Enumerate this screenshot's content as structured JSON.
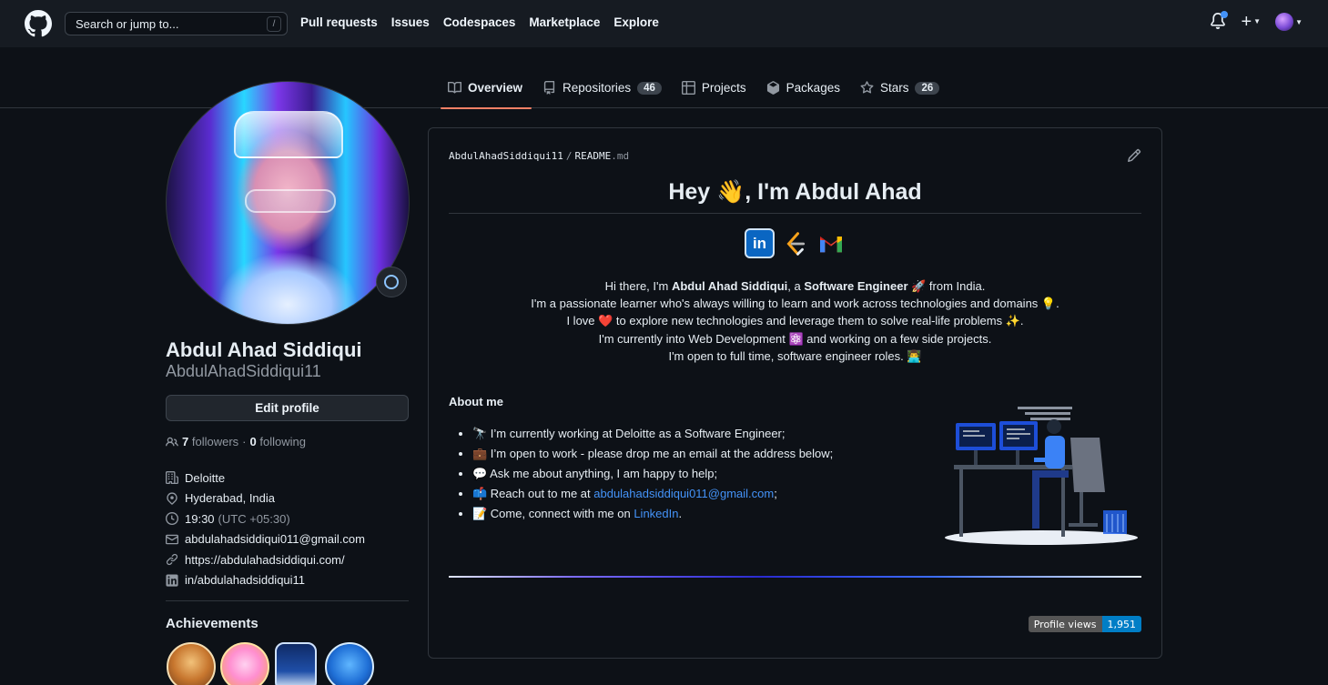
{
  "header": {
    "search_placeholder": "Search or jump to...",
    "search_shortcut": "/",
    "nav": [
      "Pull requests",
      "Issues",
      "Codespaces",
      "Marketplace",
      "Explore"
    ]
  },
  "tabs": [
    {
      "label": "Overview",
      "icon": "book-icon",
      "active": true
    },
    {
      "label": "Repositories",
      "icon": "repo-icon",
      "count": "46"
    },
    {
      "label": "Projects",
      "icon": "table-icon"
    },
    {
      "label": "Packages",
      "icon": "package-icon"
    },
    {
      "label": "Stars",
      "icon": "star-icon",
      "count": "26"
    }
  ],
  "profile": {
    "name": "Abdul Ahad Siddiqui",
    "login": "AbdulAhadSiddiqui11",
    "edit_label": "Edit profile",
    "followers_count": "7",
    "followers_label": "followers",
    "separator": "·",
    "following_count": "0",
    "following_label": "following",
    "company": "Deloitte",
    "location": "Hyderabad, India",
    "time": "19:30",
    "timezone": "(UTC +05:30)",
    "email": "abdulahadsiddiqui011@gmail.com",
    "website": "https://abdulahadsiddiqui.com/",
    "linkedin": "in/abdulahadsiddiqui11"
  },
  "achievements": {
    "title": "Achievements"
  },
  "readme": {
    "owner": "AbdulAhadSiddiqui11",
    "separator": "/",
    "file": "README",
    "ext": ".md",
    "heading": "Hey 👋, I'm Abdul Ahad",
    "intro": [
      {
        "before": "Hi there, I'm ",
        "bold1": "Abdul Ahad Siddiqui",
        "mid": ", a ",
        "bold2": "Software Engineer",
        "after": " 🚀 from India."
      },
      "I'm a passionate learner who's always willing to learn and work across technologies and domains 💡.",
      "I love ❤️ to explore new technologies and leverage them to solve real-life problems ✨.",
      "I'm currently into Web Development ⚛️ and working on a few side projects.",
      "I'm open to full time, software engineer roles. 👨‍💻"
    ],
    "about_title": "About me",
    "about_items": [
      {
        "text": "🔭 I’m currently working at Deloitte as a Software Engineer;"
      },
      {
        "text": "💼 I’m open to work - please drop me an email at the address below;"
      },
      {
        "text": "💬 Ask me about anything, I am happy to help;"
      },
      {
        "text": "📫 Reach out to me at ",
        "link": "abdulahadsiddiqui011@gmail.com",
        "after": ";"
      },
      {
        "text": "📝 Come, connect with me on ",
        "link": "LinkedIn",
        "after": "."
      }
    ],
    "views_label": "Profile views",
    "views_count": "1,951"
  },
  "colors": {
    "accent_link": "#4493f8",
    "tab_underline": "#f78166",
    "views_badge": "#007ec6"
  }
}
